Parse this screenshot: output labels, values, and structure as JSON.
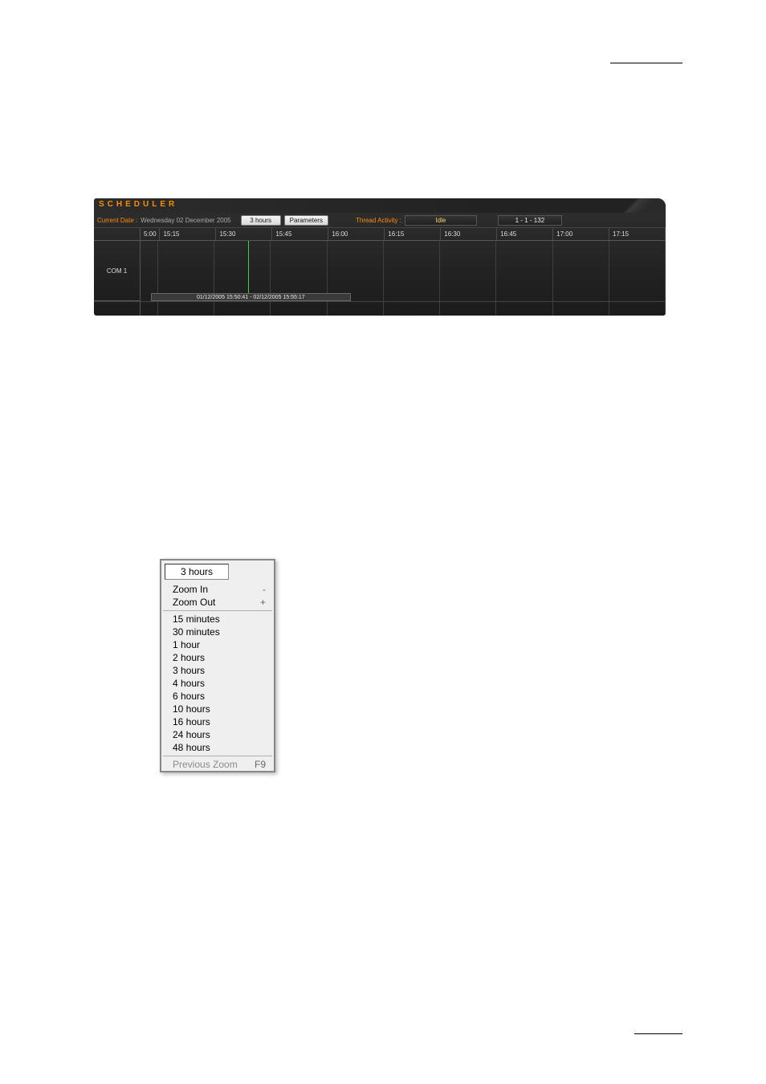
{
  "header": {
    "title": "SCHEDULER",
    "current_date_label": "Current Date :",
    "current_date_value": "Wednesday 02 December 2005",
    "zoom_button": "3 hours",
    "parameters_button": "Parameters",
    "thread_activity_label": "Thread Activity :",
    "thread_status": "Idle",
    "thread_counts": "1 - 1 - 132"
  },
  "timeline": {
    "channel": "COM 1",
    "ticks": [
      "5:00",
      "15:15",
      "15:30",
      "15:45",
      "16:00",
      "16:15",
      "16:30",
      "16:45",
      "17:00",
      "17:15"
    ],
    "now_range": "01/12/2005 15:50:41 - 02/12/2005 15:55:17"
  },
  "zoom_menu": {
    "title": "3 hours",
    "zoom_in": {
      "label": "Zoom In",
      "shortcut": "-"
    },
    "zoom_out": {
      "label": "Zoom Out",
      "shortcut": "+"
    },
    "ranges": [
      "15 minutes",
      "30 minutes",
      "1 hour",
      "2 hours",
      "3 hours",
      "4 hours",
      "6 hours",
      "10 hours",
      "16 hours",
      "24 hours",
      "48 hours"
    ],
    "previous": {
      "label": "Previous Zoom",
      "shortcut": "F9"
    }
  }
}
